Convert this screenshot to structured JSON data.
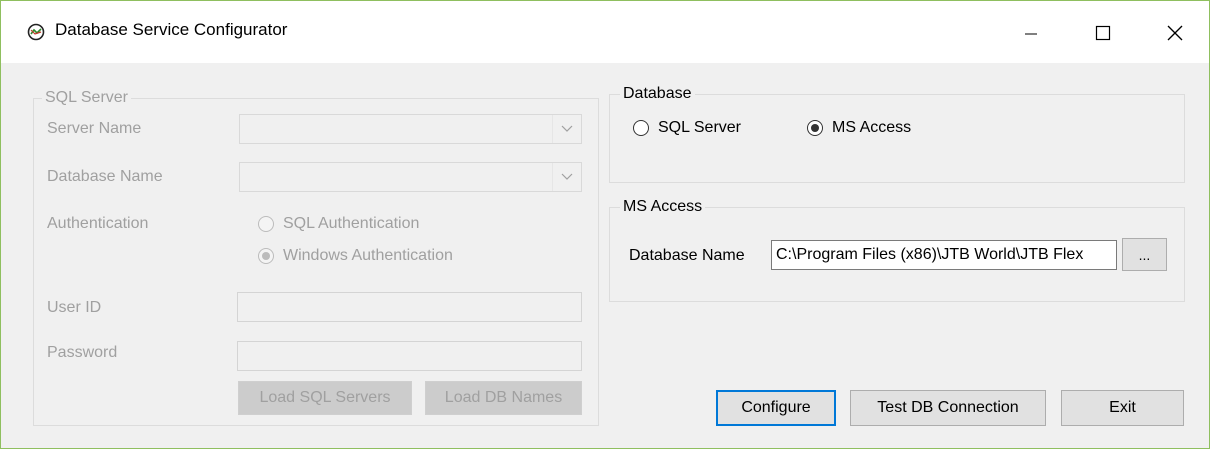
{
  "window": {
    "title": "Database Service Configurator",
    "controls": {
      "minimize": "minimize",
      "maximize": "maximize",
      "close": "close"
    }
  },
  "sql_server": {
    "group_label": "SQL Server",
    "server_name_label": "Server Name",
    "server_name_value": "",
    "database_name_label": "Database Name",
    "database_name_value": "",
    "authentication_label": "Authentication",
    "auth_options": [
      "SQL Authentication",
      "Windows Authentication"
    ],
    "auth_selected": "Windows Authentication",
    "user_id_label": "User ID",
    "user_id_value": "",
    "password_label": "Password",
    "password_value": "",
    "load_servers_button": "Load SQL Servers",
    "load_db_names_button": "Load DB Names"
  },
  "database": {
    "group_label": "Database",
    "options": [
      "SQL Server",
      "MS Access"
    ],
    "selected": "MS Access"
  },
  "ms_access": {
    "group_label": "MS Access",
    "database_name_label": "Database Name",
    "database_name_value": "C:\\Program Files (x86)\\JTB World\\JTB Flex",
    "browse_button": "..."
  },
  "actions": {
    "configure": "Configure",
    "test_connection": "Test DB Connection",
    "exit": "Exit"
  },
  "colors": {
    "focus_border": "#0078d7",
    "window_border": "#8fbf5f",
    "disabled_text": "#a0a0a0"
  }
}
